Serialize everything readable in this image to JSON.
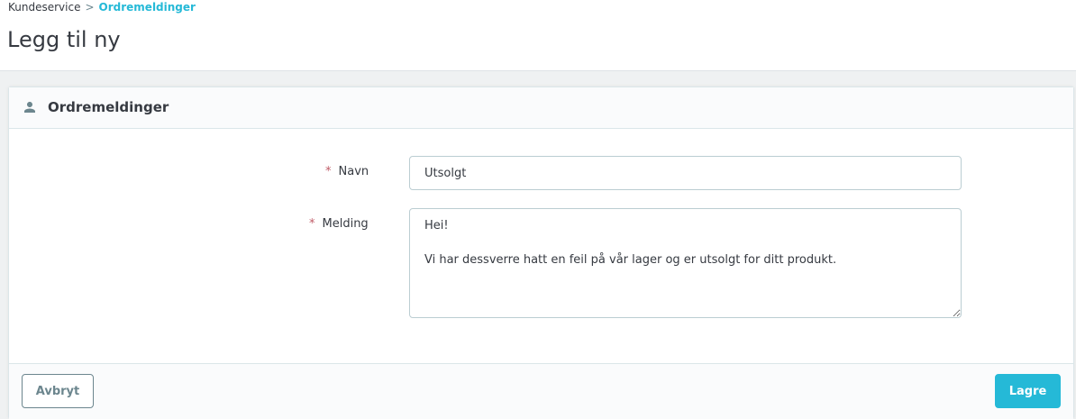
{
  "breadcrumb": {
    "parent": "Kundeservice",
    "separator": ">",
    "current": "Ordremeldinger"
  },
  "page": {
    "title": "Legg til ny"
  },
  "card": {
    "title": "Ordremeldinger",
    "icon": "person-icon"
  },
  "form": {
    "required_marker": "*",
    "name_label": "Navn",
    "name_value": "Utsolgt",
    "message_label": "Melding",
    "message_value": "Hei!\n\nVi har dessverre hatt en feil på vår lager og er utsolgt for ditt produkt."
  },
  "footer": {
    "cancel_label": "Avbryt",
    "save_label": "Lagre"
  },
  "colors": {
    "accent": "#25b9d7",
    "required": "#c05c67",
    "secondary": "#6c868e"
  }
}
